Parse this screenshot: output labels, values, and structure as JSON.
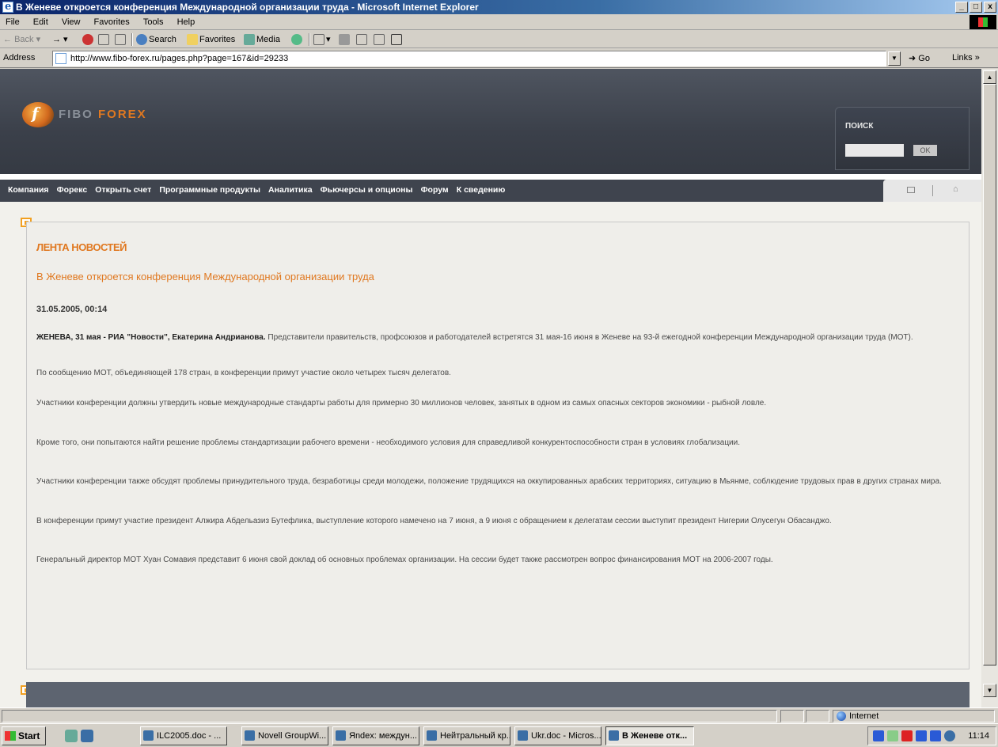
{
  "window": {
    "title": "В Женеве откроется конференция Международной организации труда - Microsoft Internet Explorer",
    "btn_min": "_",
    "btn_max": "□",
    "btn_close": "x"
  },
  "menu": [
    "File",
    "Edit",
    "View",
    "Favorites",
    "Tools",
    "Help"
  ],
  "toolbar": {
    "back": "Back",
    "search": "Search",
    "favorites": "Favorites",
    "media": "Media"
  },
  "address": {
    "label": "Address",
    "url": "http://www.fibo-forex.ru/pages.php?page=167&id=29233",
    "go": "Go",
    "links": "Links »"
  },
  "site": {
    "logo_text_a": "FIBO",
    "logo_text_b": "FOREX",
    "search_label": "ПОИСК",
    "search_ok": "OK",
    "nav": [
      "Компания",
      "Форекс",
      "Открыть счет",
      "Программные продукты",
      "Аналитика",
      "Фьючерсы и опционы",
      "Форум",
      "К сведению"
    ]
  },
  "article": {
    "section_title": "ЛЕНТА НОВОСТЕЙ",
    "headline": "В Женеве откроется конференция Международной организации труда",
    "date": "31.05.2005, 00:14",
    "lead_bold": "ЖЕНЕВА, 31 мая - РИА \"Новости\", Екатерина Андрианова.",
    "lead_text": " Представители правительств, профсоюзов и работодателей встретятся 31 мая-16 июня в Женеве на 93-й ежегодной конференции Международной организации труда (МОТ).",
    "p2": "По сообщению МОТ, объединяющей 178 стран, в конференции примут участие около четырех тысяч делегатов.",
    "p3": "Участники конференции должны утвердить новые международные стандарты работы для примерно 30 миллионов человек, занятых в одном из самых опасных секторов экономики - рыбной ловле.",
    "p4": "Кроме того, они попытаются найти решение проблемы стандартизации рабочего времени - необходимого условия для справедливой конкурентоспособности стран в условиях глобализации.",
    "p5": "Участники конференции также обсудят проблемы принудительного труда, безработицы среди молодежи, положение трудящихся на оккупированных арабских территориях, ситуацию в Мьянме, соблюдение трудовых прав в других странах мира.",
    "p6": "В конференции примут участие президент Алжира Абдельазиз Бутефлика, выступление которого намечено на 7 июня, а 9 июня с обращением к делегатам сессии выступит президент Нигерии Олусегун Обасанджо.",
    "p7": "Генеральный директор МОТ Хуан Сомавия представит 6 июня свой доклад об основных проблемах организации. На сессии будет также рассмотрен вопрос финансирования МОТ на 2006-2007 годы."
  },
  "status": {
    "zone": "Internet"
  },
  "taskbar": {
    "start": "Start",
    "tasks": [
      "ILC2005.doc - ...",
      "Novell GroupWi...",
      "Яndex: междун...",
      "Нейтральный кр...",
      "Ukr.doc - Micros...",
      "В Женеве отк..."
    ],
    "clock": "11:14"
  },
  "colors": {
    "accent": "#e07820",
    "header_bg": "#3f444e",
    "panel_bg": "#efeeea"
  }
}
